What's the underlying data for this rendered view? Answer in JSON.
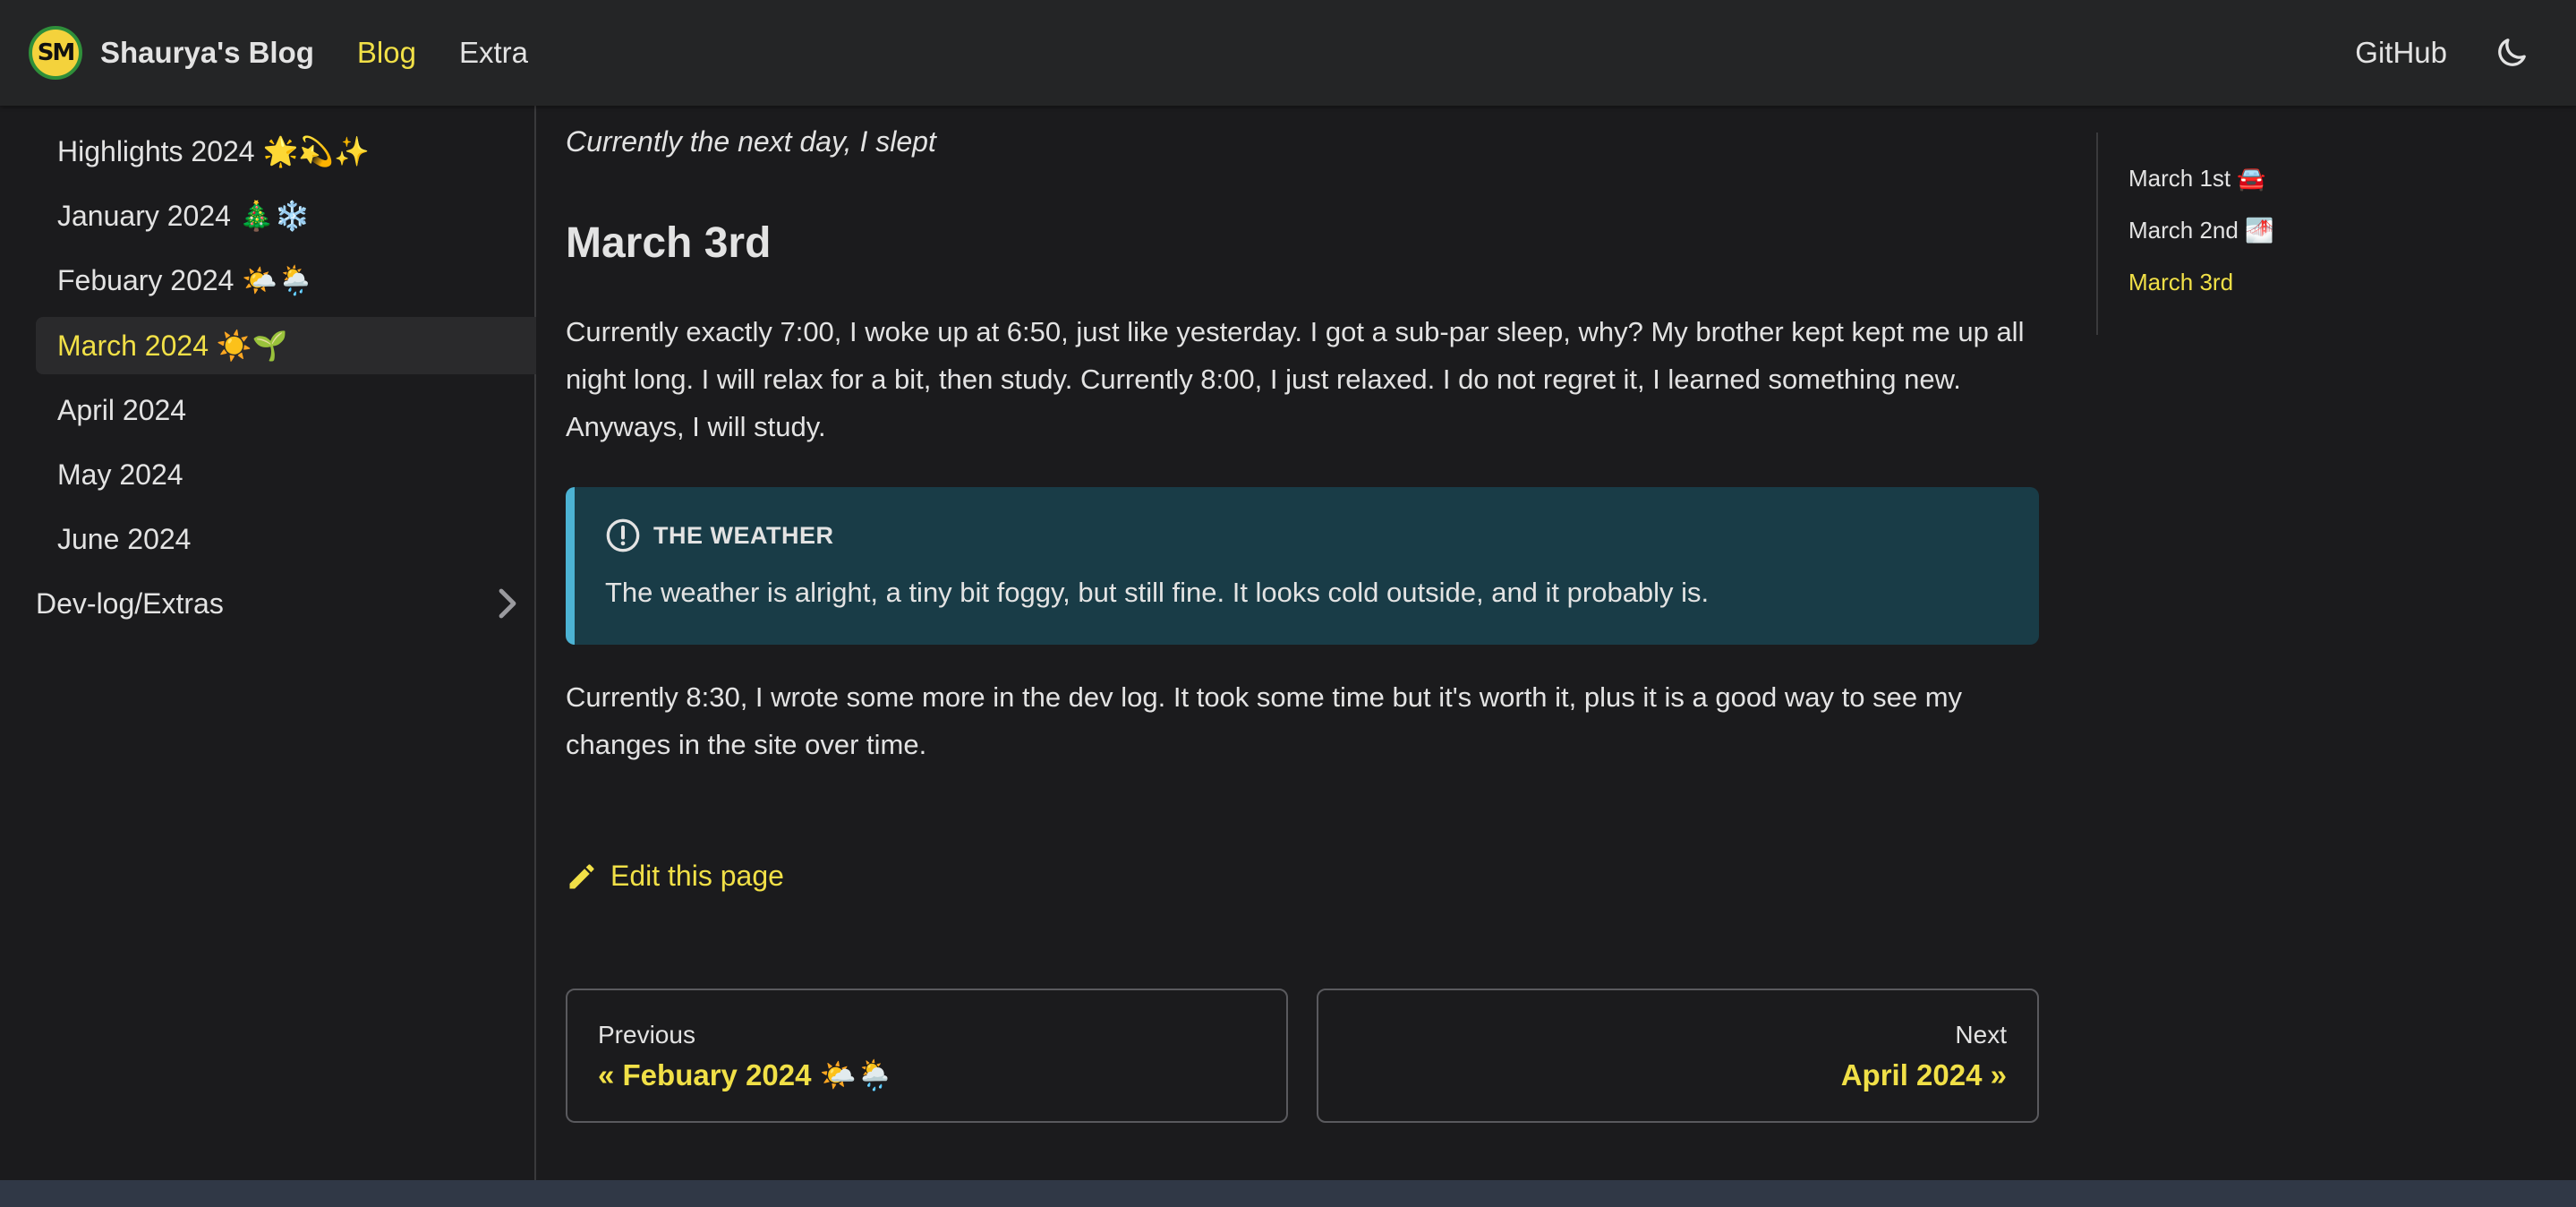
{
  "navbar": {
    "logo_text": "SM",
    "brand_title": "Shaurya's Blog",
    "links": [
      "Blog",
      "Extra"
    ],
    "github": "GitHub",
    "theme_icon": "moon-icon",
    "accent_color": "#f1e047"
  },
  "sidebar": {
    "items": [
      {
        "label": "Highlights 2024 🌟💫✨"
      },
      {
        "label": "January 2024 🎄❄️"
      },
      {
        "label": "Febuary 2024 🌤️🌦️"
      },
      {
        "label": "March 2024 ☀️🌱"
      },
      {
        "label": "April 2024"
      },
      {
        "label": "May 2024"
      },
      {
        "label": "June 2024"
      }
    ],
    "active_item": "March 2024 ☀️🌱",
    "category": {
      "label": "Dev-log/Extras",
      "icon": "chevron-right-icon"
    }
  },
  "main": {
    "intro_italic": "Currently the next day, I slept",
    "heading": "March 3rd",
    "paragraph1": "Currently exactly 7:00, I woke up at 6:50, just like yesterday. I got a sub-par sleep, why? My brother kept kept me up all night long. I will relax for a bit, then study. Currently 8:00, I just relaxed. I do not regret it, I learned something new. Anyways, I will study.",
    "admonition": {
      "title": "THE WEATHER",
      "icon": "info-icon",
      "body": "The weather is alright, a tiny bit foggy, but still fine. It looks cold outside, and it probably is.",
      "bg_color": "#193c47",
      "border_color": "#4cb3d4"
    },
    "paragraph2": "Currently 8:30, I wrote some more in the dev log. It took some time but it's worth it, plus it is a good way to see my changes in the site over time.",
    "edit_link": "Edit this page",
    "pager": {
      "prev_sub": "Previous",
      "prev_title": "« Febuary 2024 🌤️🌦️",
      "next_sub": "Next",
      "next_title": "April 2024 »"
    }
  },
  "toc": {
    "items": [
      "March 1st 🚘",
      "March 2nd 🌁",
      "March 3rd"
    ],
    "active": "March 3rd"
  }
}
